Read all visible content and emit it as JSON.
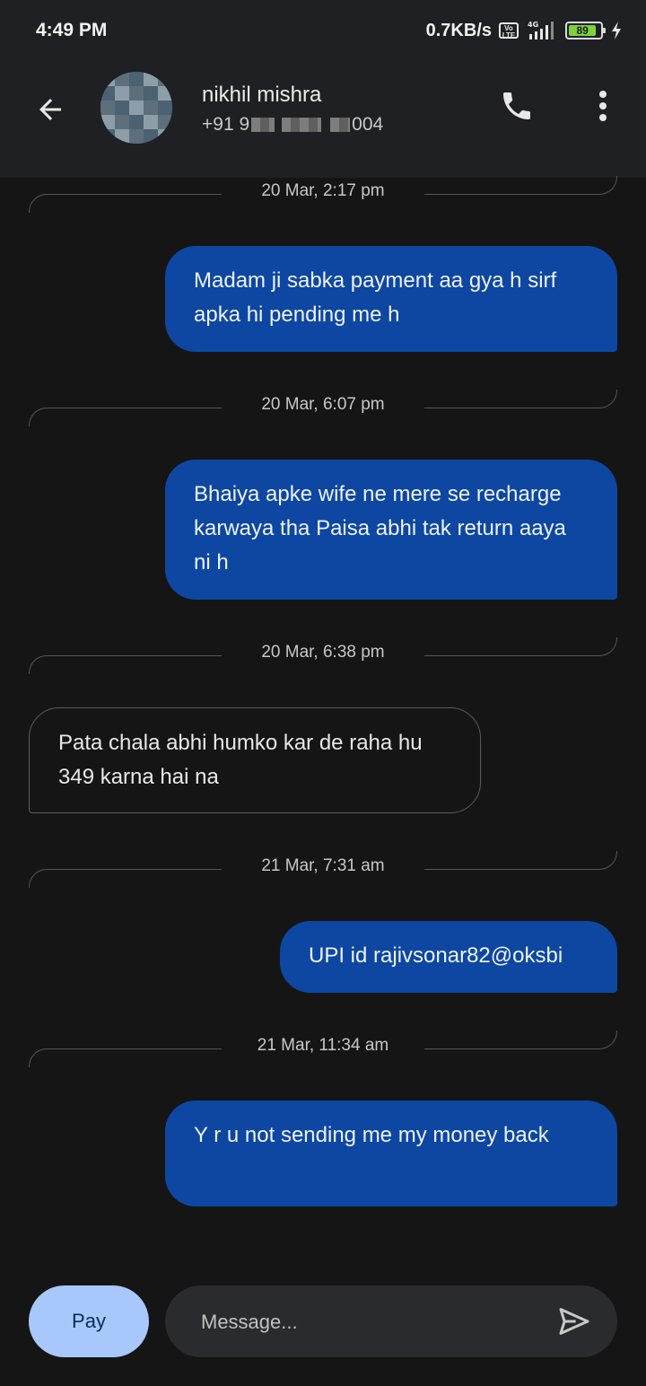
{
  "status_bar": {
    "time": "4:49 PM",
    "net_speed": "0.7KB/s",
    "volte_label": "VoLTE",
    "network_type": "4G",
    "battery_level": "89"
  },
  "header": {
    "contact_name": "nikhil mishra",
    "phone_prefix": "+91 9",
    "phone_suffix": "004",
    "back_icon": "arrow-back-icon",
    "call_icon": "phone-icon",
    "more_icon": "more-vert-icon"
  },
  "conversation": {
    "items": [
      {
        "kind": "date",
        "text": "20 Mar, 2:17 pm"
      },
      {
        "kind": "outgoing",
        "text": "Madam ji sabka payment aa gya h sirf apka hi pending me h"
      },
      {
        "kind": "date",
        "text": "20 Mar, 6:07 pm"
      },
      {
        "kind": "outgoing",
        "text": "Bhaiya apke wife ne mere se recharge karwaya tha Paisa abhi tak return aaya ni h"
      },
      {
        "kind": "date",
        "text": "20 Mar, 6:38 pm"
      },
      {
        "kind": "incoming",
        "text": "Pata chala abhi humko kar de raha hu 349 karna hai na"
      },
      {
        "kind": "date",
        "text": "21 Mar, 7:31 am"
      },
      {
        "kind": "outgoing",
        "text": "UPI id  rajivsonar82@oksbi"
      },
      {
        "kind": "date",
        "text": "21 Mar, 11:34 am"
      },
      {
        "kind": "outgoing",
        "text": "Y r u not sending me my money back"
      }
    ]
  },
  "composer": {
    "pay_label": "Pay",
    "message_placeholder": "Message...",
    "send_icon": "send-icon"
  },
  "colors": {
    "outgoing_bubble": "#0d47a1",
    "pay_button": "#a8c7fa",
    "background": "#151516",
    "header": "#1f2023"
  }
}
